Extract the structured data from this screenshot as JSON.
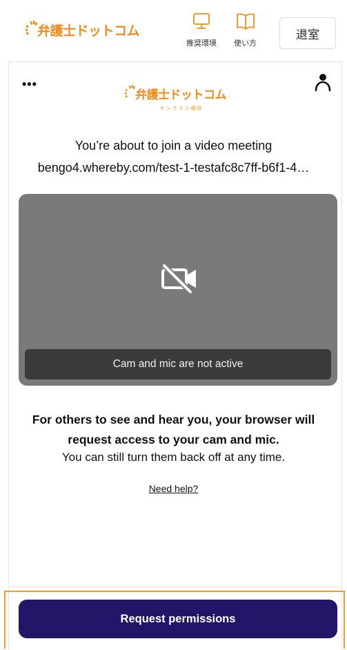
{
  "header": {
    "brand_name": "弁護士ドットコム",
    "env_label": "推奨環境",
    "howto_label": "使い方",
    "exit_label": "退室"
  },
  "meeting": {
    "logo_name": "弁護士ドットコム",
    "logo_sub": "オンライン相談",
    "more_label": "•••",
    "join_title": "You’re about to join a video meeting",
    "join_url": "bengo4.whereby.com/test-1-testafc8c7ff-b6f1-4…",
    "status_text": "Cam and mic are not active",
    "info_bold_line1": "For others to see and hear you, your browser will",
    "info_bold_line2": "request access to your cam and mic.",
    "info_normal": "You can still turn them back off at any time.",
    "help_link": "Need help?",
    "request_button": "Request permissions"
  },
  "colors": {
    "brand_orange": "#f08c1e",
    "primary_button": "#231669",
    "video_bg": "#7a7a7a",
    "status_bg": "#3b3b3b",
    "highlight": "#f39a2e"
  },
  "icons": {
    "env": "monitor-icon",
    "howto": "book-icon",
    "more": "more-dots-icon",
    "person": "person-icon",
    "camera_off": "camera-off-icon",
    "brand_spark": "spark-icon"
  }
}
